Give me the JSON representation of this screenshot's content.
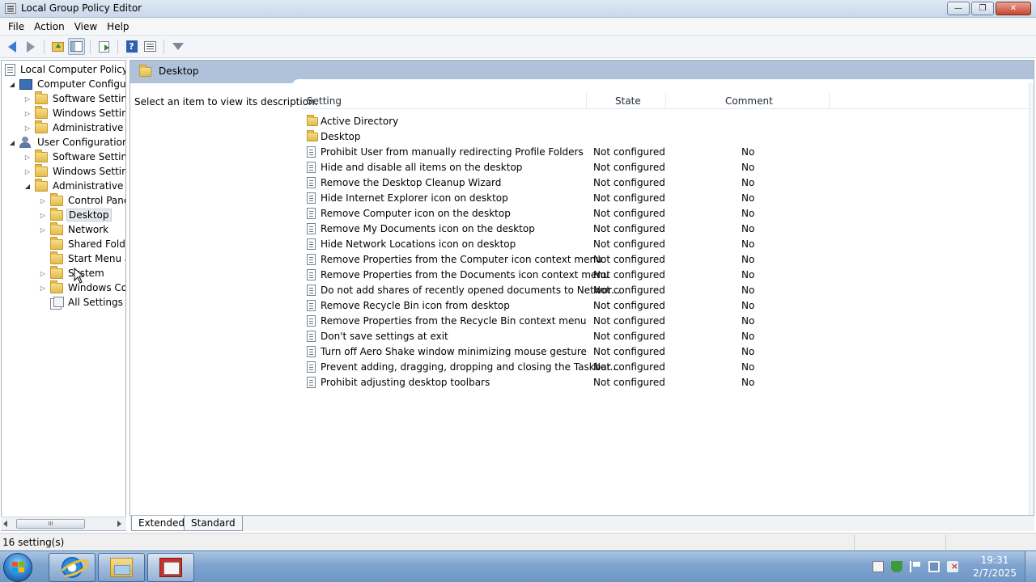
{
  "window": {
    "title": "Local Group Policy Editor"
  },
  "menu": [
    "File",
    "Action",
    "View",
    "Help"
  ],
  "tree": {
    "items": [
      {
        "label": "Local Computer Policy",
        "level": 0
      },
      {
        "label": "Computer Configura",
        "level": 1
      },
      {
        "label": "Software Settings",
        "level": 2
      },
      {
        "label": "Windows Setting",
        "level": 2
      },
      {
        "label": "Administrative Te",
        "level": 2
      },
      {
        "label": "User Configuration",
        "level": 1
      },
      {
        "label": "Software Settings",
        "level": 2
      },
      {
        "label": "Windows Setting",
        "level": 2
      },
      {
        "label": "Administrative Te",
        "level": 2
      },
      {
        "label": "Control Panel",
        "level": 3
      },
      {
        "label": "Desktop",
        "level": 3
      },
      {
        "label": "Network",
        "level": 3
      },
      {
        "label": "Shared Folder",
        "level": 3
      },
      {
        "label": "Start Menu ar",
        "level": 3
      },
      {
        "label": "System",
        "level": 3
      },
      {
        "label": "Windows Cor",
        "level": 3
      },
      {
        "label": "All Settings",
        "level": 3
      }
    ],
    "scroll_grip": "III"
  },
  "right": {
    "header_title": "Desktop",
    "description": "Select an item to view its description.",
    "columns": {
      "setting": "Setting",
      "state": "State",
      "comment": "Comment"
    },
    "rows": [
      {
        "type": "folder",
        "setting": "Active Directory",
        "state": "",
        "comment": ""
      },
      {
        "type": "folder",
        "setting": "Desktop",
        "state": "",
        "comment": ""
      },
      {
        "type": "policy",
        "setting": "Prohibit User from manually redirecting Profile Folders",
        "state": "Not configured",
        "comment": "No"
      },
      {
        "type": "policy",
        "setting": "Hide and disable all items on the desktop",
        "state": "Not configured",
        "comment": "No"
      },
      {
        "type": "policy",
        "setting": "Remove the Desktop Cleanup Wizard",
        "state": "Not configured",
        "comment": "No"
      },
      {
        "type": "policy",
        "setting": "Hide Internet Explorer icon on desktop",
        "state": "Not configured",
        "comment": "No"
      },
      {
        "type": "policy",
        "setting": "Remove Computer icon on the desktop",
        "state": "Not configured",
        "comment": "No"
      },
      {
        "type": "policy",
        "setting": "Remove My Documents icon on the desktop",
        "state": "Not configured",
        "comment": "No"
      },
      {
        "type": "policy",
        "setting": "Hide Network Locations icon on desktop",
        "state": "Not configured",
        "comment": "No"
      },
      {
        "type": "policy",
        "setting": "Remove Properties from the Computer icon context menu",
        "state": "Not configured",
        "comment": "No"
      },
      {
        "type": "policy",
        "setting": "Remove Properties from the Documents icon context menu",
        "state": "Not configured",
        "comment": "No"
      },
      {
        "type": "policy",
        "setting": "Do not add shares of recently opened documents to Networ...",
        "state": "Not configured",
        "comment": "No"
      },
      {
        "type": "policy",
        "setting": "Remove Recycle Bin icon from desktop",
        "state": "Not configured",
        "comment": "No"
      },
      {
        "type": "policy",
        "setting": "Remove Properties from the Recycle Bin context menu",
        "state": "Not configured",
        "comment": "No"
      },
      {
        "type": "policy",
        "setting": "Don't save settings at exit",
        "state": "Not configured",
        "comment": "No"
      },
      {
        "type": "policy",
        "setting": "Turn off Aero Shake window minimizing mouse gesture",
        "state": "Not configured",
        "comment": "No"
      },
      {
        "type": "policy",
        "setting": "Prevent adding, dragging, dropping and closing the Taskbar...",
        "state": "Not configured",
        "comment": "No"
      },
      {
        "type": "policy",
        "setting": "Prohibit adjusting desktop toolbars",
        "state": "Not configured",
        "comment": "No"
      }
    ]
  },
  "tabs": [
    "Extended",
    "Standard"
  ],
  "status": {
    "text": "16 setting(s)"
  },
  "taskbar": {
    "time": "19:31",
    "date": "2/7/2025"
  }
}
